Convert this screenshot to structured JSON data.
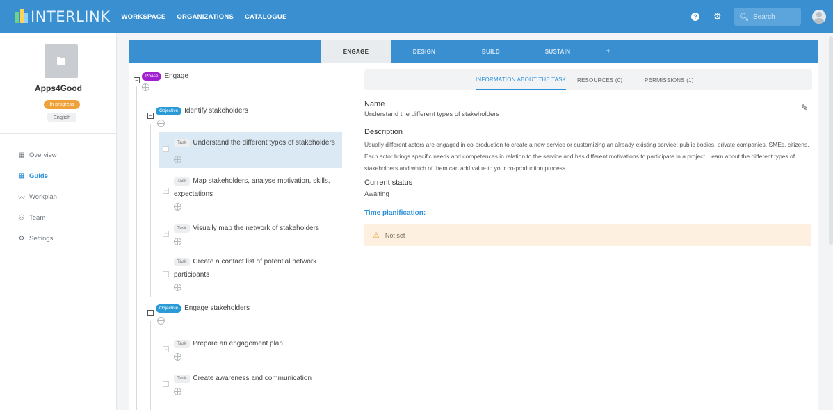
{
  "app": {
    "logo_text": "INTERLINK",
    "nav": [
      "WORKSPACE",
      "ORGANIZATIONS",
      "CATALOGUE"
    ],
    "search_placeholder": "Search",
    "help_glyph": "?"
  },
  "sidebar": {
    "project_name": "Apps4Good",
    "status_badge": "In progress",
    "language_badge": "English",
    "items": [
      {
        "label": "Overview",
        "icon": "grid-icon"
      },
      {
        "label": "Guide",
        "icon": "guide-icon"
      },
      {
        "label": "Workplan",
        "icon": "chart-line-icon"
      },
      {
        "label": "Team",
        "icon": "team-icon"
      },
      {
        "label": "Settings",
        "icon": "gear-icon"
      }
    ]
  },
  "phases": {
    "tabs": [
      "ENGAGE",
      "DESIGN",
      "BUILD",
      "SUSTAIN",
      "+"
    ],
    "active": "ENGAGE"
  },
  "tree": {
    "phase": {
      "pill": "Phase",
      "title": "Engage"
    },
    "objectives": [
      {
        "pill": "Objective",
        "title": "Identify stakeholders",
        "tasks": [
          {
            "pill": "Task",
            "title": "Understand the different types of stakeholders"
          },
          {
            "pill": "Task",
            "title": "Map stakeholders, analyse motivation, skills, expectations"
          },
          {
            "pill": "Task",
            "title": "Visually map the network of stakeholders"
          },
          {
            "pill": "Task",
            "title": "Create a contact list of potential network participants"
          }
        ]
      },
      {
        "pill": "Objective",
        "title": "Engage stakeholders",
        "tasks": [
          {
            "pill": "Task",
            "title": "Prepare an engagement plan"
          },
          {
            "pill": "Task",
            "title": "Create awareness and communication"
          }
        ]
      }
    ]
  },
  "detail": {
    "tabs": [
      "INFORMATION ABOUT THE TASK",
      "RESOURCES (0)",
      "PERMISSIONS (1)"
    ],
    "name_label": "Name",
    "name_value": "Understand the different types of stakeholders",
    "description_label": "Description",
    "description_value": "Usually different actors are engaged in co-production to create a new service or customizing an already existing service: public bodies, private companies, SMEs, citizens. Each actor brings specific needs and competences in relation to the service and has different motivations to participate in a project. Learn about the different types of stakeholders and which of them can add value to your co-production process",
    "status_label": "Current status",
    "status_value": "Awaiting",
    "time_label": "Time planification:",
    "time_value": "Not set"
  },
  "colors": {
    "primary": "#3a8fd0",
    "phase_pill": "#a01fd0",
    "objective_pill": "#2b9bd8",
    "progress_badge": "#f0a13a",
    "notset_bg": "#fdf0e0"
  }
}
